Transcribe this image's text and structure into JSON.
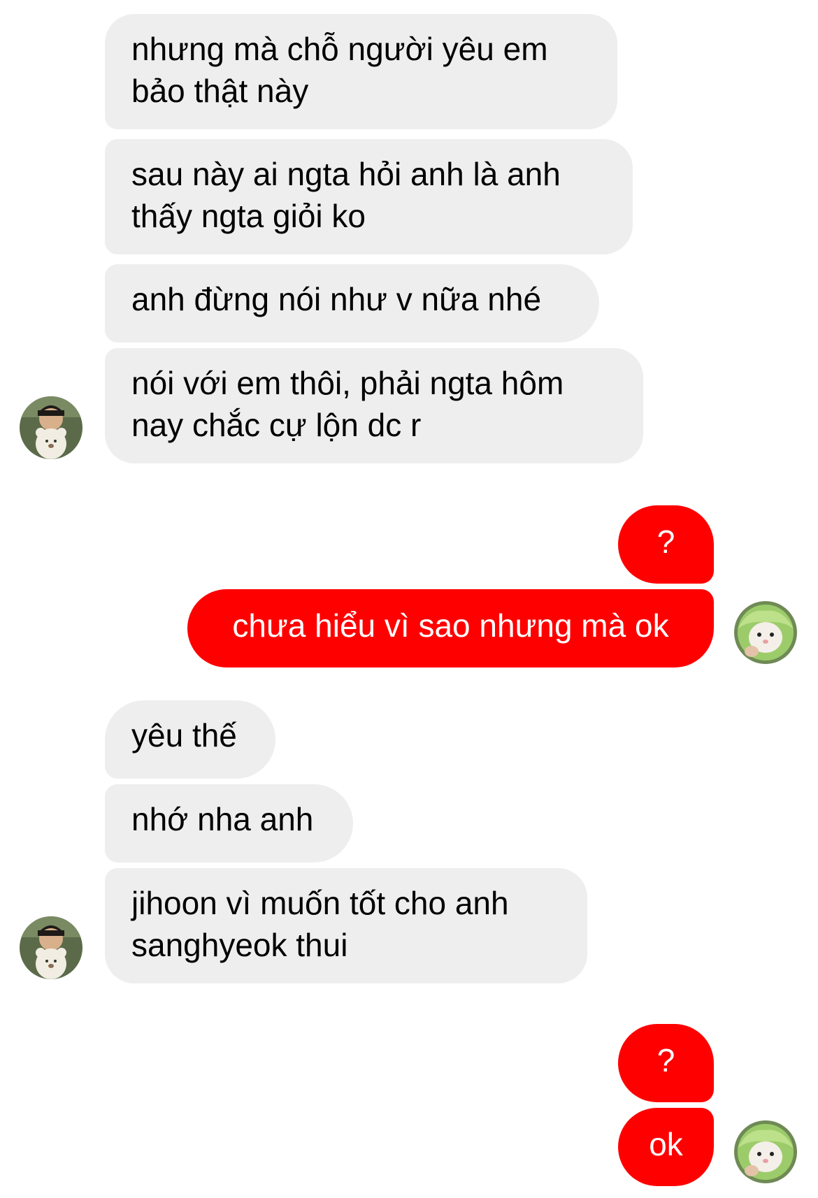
{
  "conversation": {
    "messages": [
      {
        "side": "incoming",
        "text": "nhưng mà chỗ người yêu em\nbảo thật này"
      },
      {
        "side": "incoming",
        "text": "sau này ai ngta hỏi anh là anh\nthấy ngta giỏi ko"
      },
      {
        "side": "incoming",
        "text": "anh đừng nói như v nữa nhé"
      },
      {
        "side": "incoming",
        "text": "nói với em thôi, phải ngta hôm\nnay chắc cự lộn dc r"
      },
      {
        "side": "outgoing",
        "text": "?"
      },
      {
        "side": "outgoing",
        "text": "chưa hiểu vì sao nhưng mà ok"
      },
      {
        "side": "incoming",
        "text": "yêu thế"
      },
      {
        "side": "incoming",
        "text": "nhớ nha anh"
      },
      {
        "side": "incoming",
        "text": "jihoon vì muốn tốt cho anh\nsanghyeok thui"
      },
      {
        "side": "outgoing",
        "text": "?"
      },
      {
        "side": "outgoing",
        "text": "ok"
      }
    ]
  },
  "avatars": {
    "incoming": "child-with-teddy-bear-avatar",
    "outgoing": "hamster-in-lettuce-avatar"
  },
  "colors": {
    "incoming_bubble": "#eeeeef",
    "outgoing_bubble": "#ff0000",
    "outgoing_text": "#ffffff",
    "incoming_text": "#000000"
  }
}
